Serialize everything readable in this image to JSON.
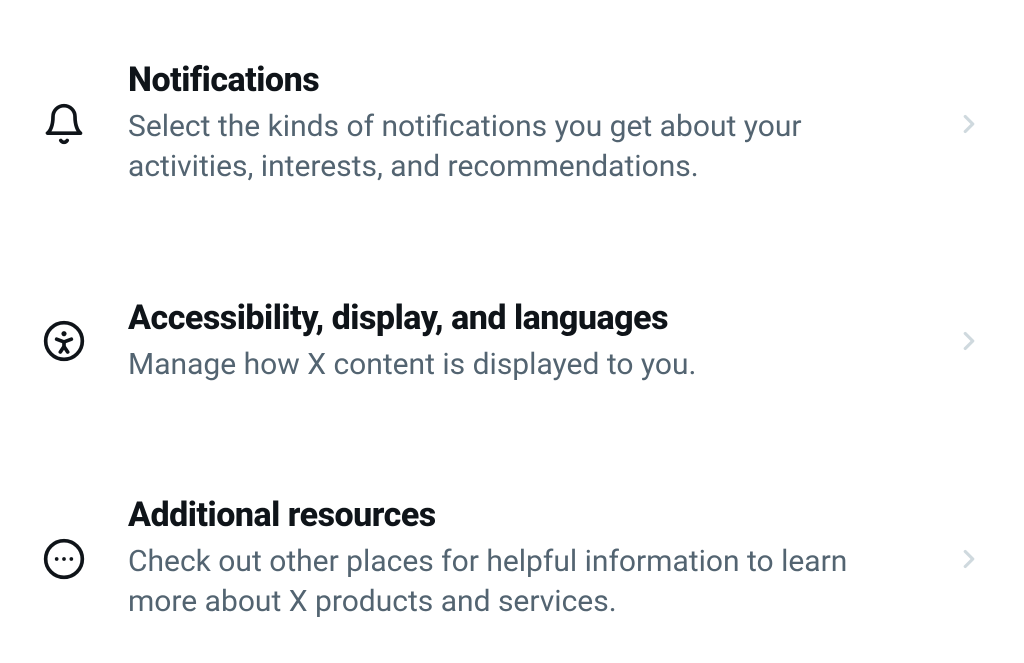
{
  "settings": {
    "items": [
      {
        "icon": "bell",
        "title": "Notifications",
        "description": "Select the kinds of notifications you get about your activities, interests, and recommendations."
      },
      {
        "icon": "accessibility",
        "title": "Accessibility, display, and languages",
        "description": "Manage how X content is displayed to you."
      },
      {
        "icon": "more",
        "title": "Additional resources",
        "description": "Check out other places for helpful information to learn more about X products and services."
      }
    ]
  }
}
